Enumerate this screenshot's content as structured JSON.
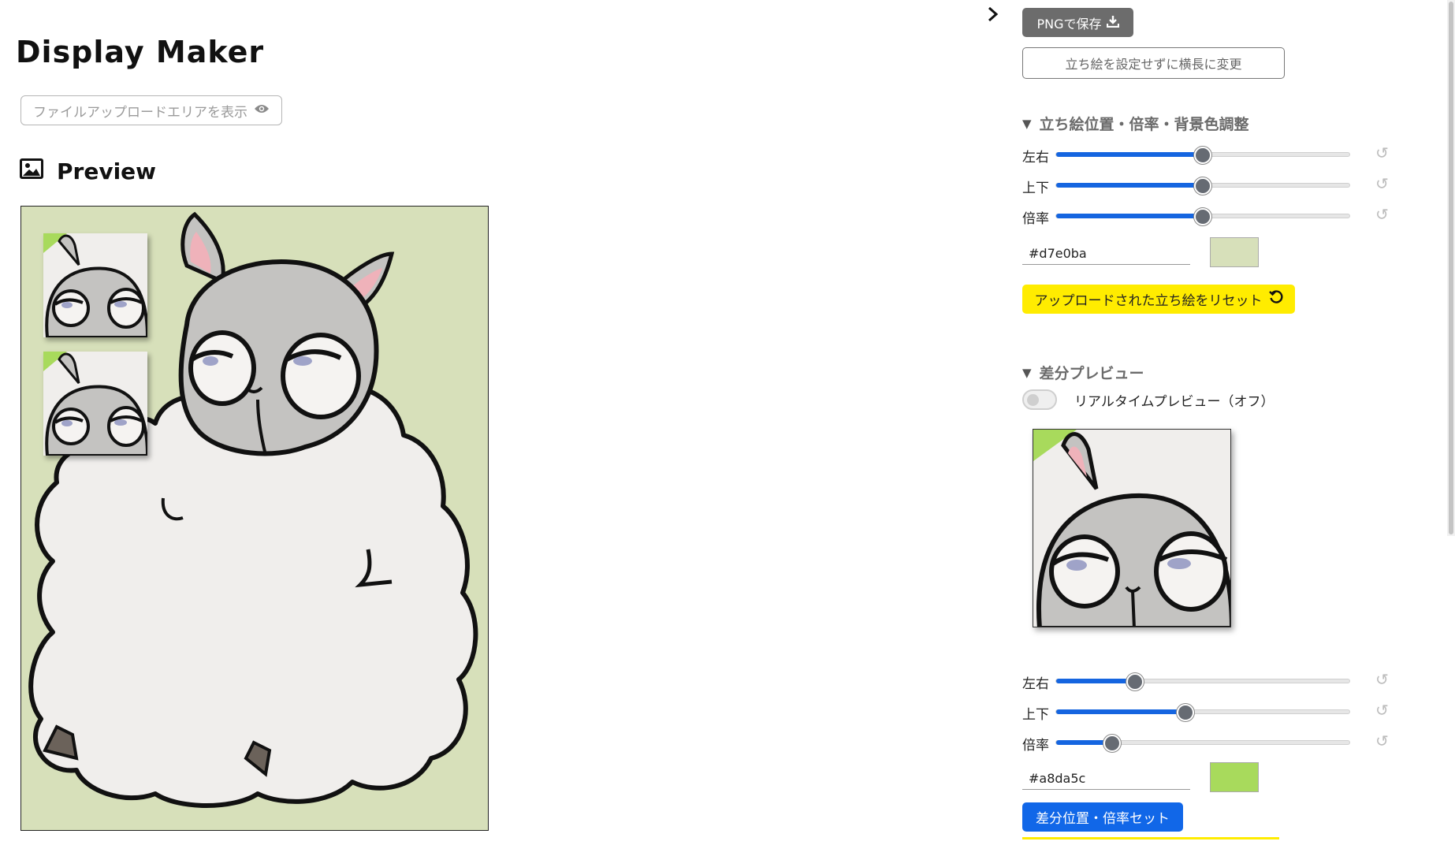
{
  "app": {
    "title": "Display Maker"
  },
  "upload_toggle": {
    "label": "ファイルアップロードエリアを表示",
    "icon": "eye-icon"
  },
  "preview": {
    "heading": "Preview",
    "icon": "image-icon",
    "background": "#d7e0ba"
  },
  "toolbar": {
    "save_png_label": "PNGで保存",
    "landscape_label": "立ち絵を設定せずに横長に変更"
  },
  "position_section": {
    "heading": "立ち絵位置・倍率・背景色調整",
    "sliders": [
      {
        "label": "左右",
        "value": 0.5
      },
      {
        "label": "上下",
        "value": 0.5
      },
      {
        "label": "倍率",
        "value": 0.5
      }
    ],
    "color_value": "#d7e0ba",
    "reset_label": "アップロードされた立ち絵をリセット"
  },
  "diff_section": {
    "heading": "差分プレビュー",
    "realtime_label": "リアルタイムプレビュー（オフ）",
    "realtime_on": false,
    "sliders": [
      {
        "label": "左右",
        "value": 0.27
      },
      {
        "label": "上下",
        "value": 0.44
      },
      {
        "label": "倍率",
        "value": 0.19
      }
    ],
    "color_value": "#a8da5c",
    "set_label": "差分位置・倍率セット"
  },
  "colors": {
    "accent_blue": "#1167e8",
    "yellow": "#ffec00",
    "sheep_wool": "#f0eeec",
    "sheep_face": "#c4c3c1"
  }
}
